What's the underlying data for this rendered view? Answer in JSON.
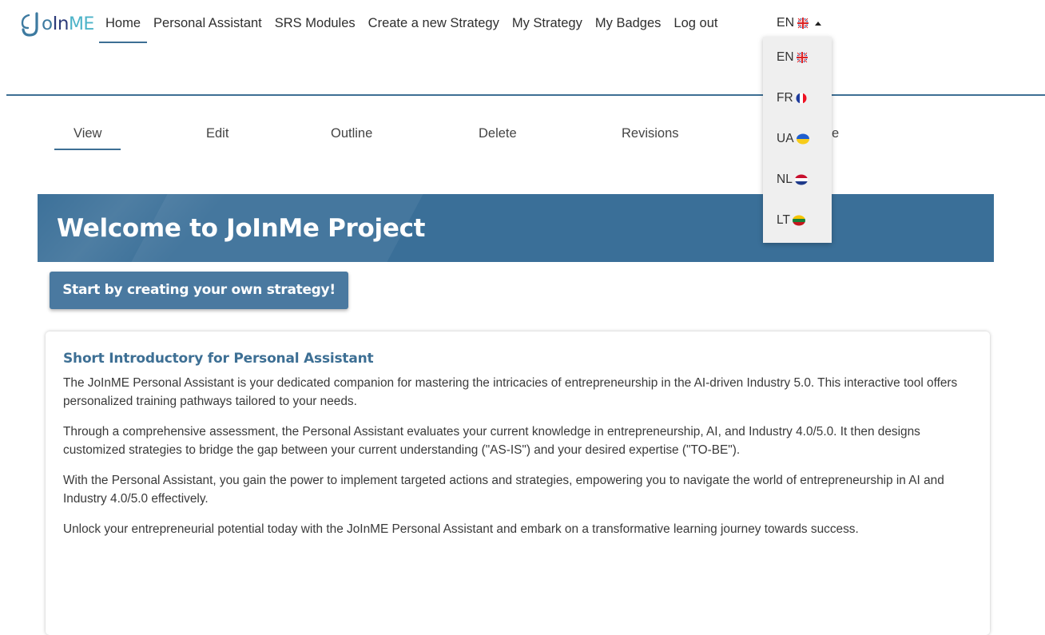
{
  "logo": {
    "part_a": "J",
    "part_b": "o",
    "part_c": "In",
    "part_d": "ME"
  },
  "nav": {
    "items": [
      {
        "label": "Home",
        "active": true
      },
      {
        "label": "Personal Assistant"
      },
      {
        "label": "SRS Modules"
      },
      {
        "label": "Create a new Strategy"
      },
      {
        "label": "My Strategy"
      },
      {
        "label": "My Badges"
      },
      {
        "label": "Log out"
      }
    ],
    "language": {
      "current": "EN",
      "flag": "uk-flag-icon"
    }
  },
  "tabs": [
    {
      "label": "View",
      "active": true
    },
    {
      "label": "Edit"
    },
    {
      "label": "Outline"
    },
    {
      "label": "Delete"
    },
    {
      "label": "Revisions"
    },
    {
      "label": "e"
    }
  ],
  "languages": [
    {
      "code": "EN",
      "flag": "uk-flag-icon"
    },
    {
      "code": "FR",
      "flag": "france-flag-icon"
    },
    {
      "code": "UA",
      "flag": "ukraine-flag-icon"
    },
    {
      "code": "NL",
      "flag": "netherlands-flag-icon"
    },
    {
      "code": "LT",
      "flag": "lithuania-flag-icon"
    }
  ],
  "hero": {
    "title": "Welcome to JoInMe Project"
  },
  "cta": {
    "label": "Start by creating your own strategy!"
  },
  "intro": {
    "title": "Short Introductory for Personal Assistant",
    "paragraphs": [
      "The JoInME Personal Assistant is your dedicated companion for mastering the intricacies of entrepreneurship in the AI-driven Industry 5.0. This interactive tool offers personalized training pathways tailored to your needs.",
      "Through a comprehensive assessment, the Personal Assistant evaluates your current knowledge in entrepreneurship, AI, and Industry 4.0/5.0. It then designs customized strategies to bridge the gap between your current understanding (\"AS-IS\") and your desired expertise (\"TO-BE\").",
      "With the Personal Assistant, you gain the power to implement targeted actions and strategies, empowering you to navigate the world of entrepreneurship in AI and Industry 4.0/5.0 effectively.",
      "Unlock your entrepreneurial potential today with the JoInME Personal Assistant and embark on a transformative learning journey towards success."
    ]
  },
  "colors": {
    "primary": "#3d6f94",
    "hero": "#3a6f98",
    "button": "#4a79a0",
    "dropdown_bg": "#efefef"
  }
}
